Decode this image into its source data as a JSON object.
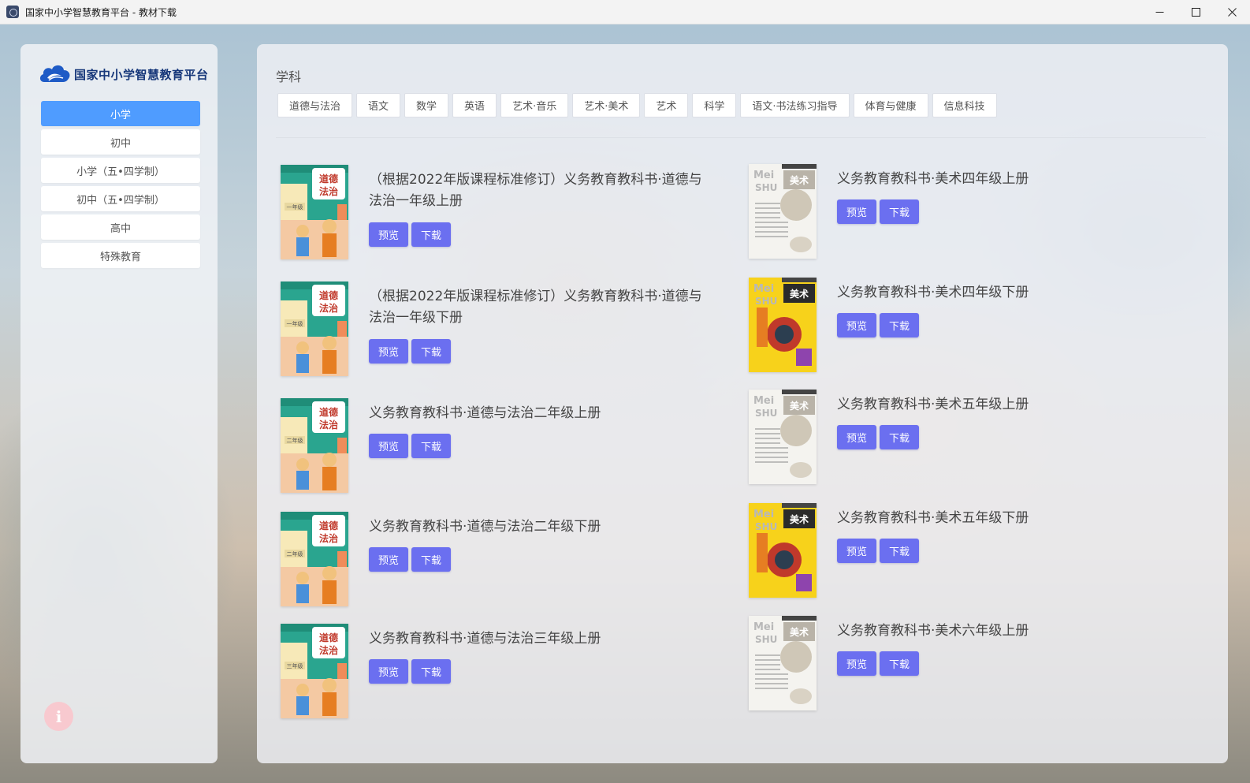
{
  "window": {
    "title": "国家中小学智慧教育平台 - 教材下载",
    "minimize": "—",
    "maximize": "☐",
    "close": "✕"
  },
  "sidebar": {
    "logo_text": "国家中小学智慧教育平台",
    "items": [
      {
        "label": "小学",
        "active": true
      },
      {
        "label": "初中",
        "active": false
      },
      {
        "label": "小学（五•四学制）",
        "active": false
      },
      {
        "label": "初中（五•四学制）",
        "active": false
      },
      {
        "label": "高中",
        "active": false
      },
      {
        "label": "特殊教育",
        "active": false
      }
    ],
    "info_icon": "i"
  },
  "main": {
    "section_label": "学科",
    "subjects": [
      "道德与法治",
      "语文",
      "数学",
      "英语",
      "艺术·音乐",
      "艺术·美术",
      "艺术",
      "科学",
      "语文·书法练习指导",
      "体育与健康",
      "信息科技"
    ],
    "preview_label": "预览",
    "download_label": "下载",
    "left_books": [
      {
        "title": "（根据2022年版课程标准修订）义务教育教科书·道德与法治一年级上册",
        "cover": "morality-1a",
        "grade": "一年级"
      },
      {
        "title": "（根据2022年版课程标准修订）义务教育教科书·道德与法治一年级下册",
        "cover": "morality-1b",
        "grade": "一年级"
      },
      {
        "title": "义务教育教科书·道德与法治二年级上册",
        "cover": "morality-2a",
        "grade": "二年级"
      },
      {
        "title": "义务教育教科书·道德与法治二年级下册",
        "cover": "morality-2b",
        "grade": "二年级"
      },
      {
        "title": "义务教育教科书·道德与法治三年级上册",
        "cover": "morality-3a",
        "grade": "三年级"
      }
    ],
    "right_books": [
      {
        "title": "义务教育教科书·美术四年级上册",
        "cover": "art-white"
      },
      {
        "title": "义务教育教科书·美术四年级下册",
        "cover": "art-yellow"
      },
      {
        "title": "义务教育教科书·美术五年级上册",
        "cover": "art-white"
      },
      {
        "title": "义务教育教科书·美术五年级下册",
        "cover": "art-yellow"
      },
      {
        "title": "义务教育教科书·美术六年级上册",
        "cover": "art-white"
      }
    ],
    "cover_text": {
      "morality_title_top": "道德",
      "morality_title_bottom": "法治",
      "art_title": "美术",
      "art_letters_top": "Mei",
      "art_letters_bottom": "SHU"
    }
  },
  "colors": {
    "accent": "#4f9cff",
    "button": "#6b6ff0",
    "logo": "#16377a"
  }
}
